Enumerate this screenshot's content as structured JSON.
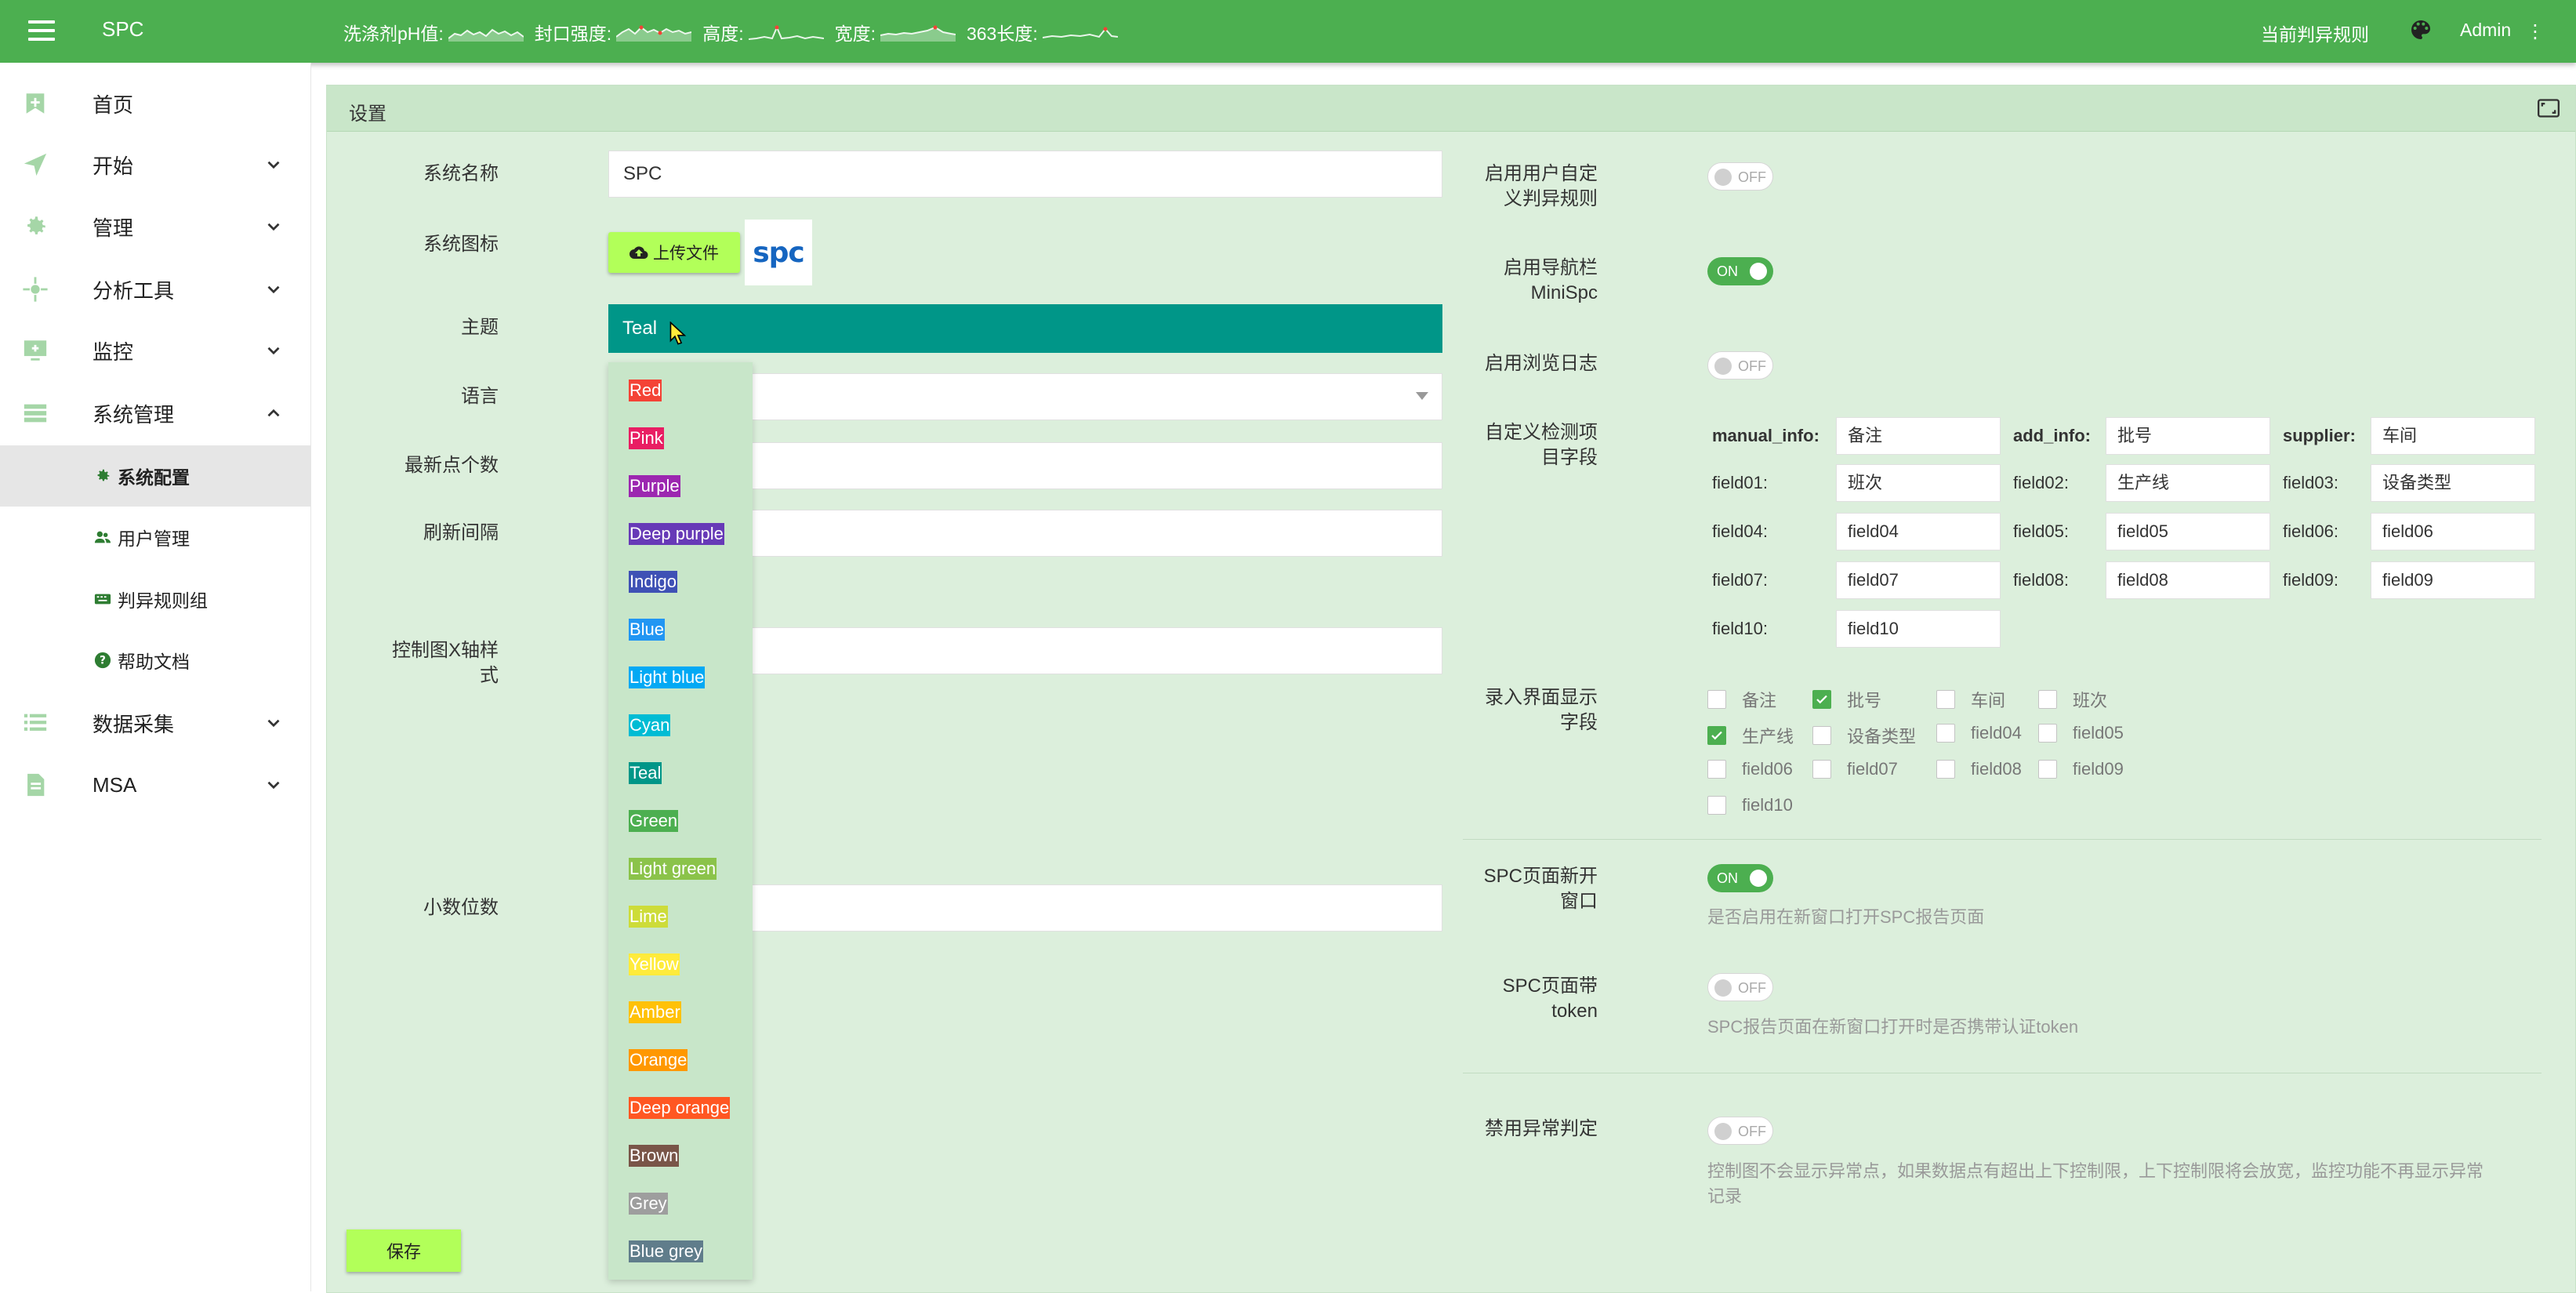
{
  "topbar": {
    "title": "SPC",
    "metrics": [
      {
        "label": "洗涤剂pH值:"
      },
      {
        "label": "封口强度:"
      },
      {
        "label": "高度:"
      },
      {
        "label": "宽度:"
      },
      {
        "label": "363长度:"
      }
    ],
    "rule_link": "当前判异规则",
    "user": "Admin",
    "more": "⋮"
  },
  "sidebar": {
    "items": [
      {
        "label": "首页",
        "icon": "home-plus-icon"
      },
      {
        "label": "开始",
        "icon": "send-icon"
      },
      {
        "label": "管理",
        "icon": "gear-icon"
      },
      {
        "label": "分析工具",
        "icon": "crosshair-icon"
      },
      {
        "label": "监控",
        "icon": "monitor-icon"
      },
      {
        "label": "系统管理",
        "icon": "list-icon"
      }
    ],
    "sub_items": [
      {
        "label": "系统配置",
        "icon": "gear-icon"
      },
      {
        "label": "用户管理",
        "icon": "users-icon"
      },
      {
        "label": "判异规则组",
        "icon": "keyboard-icon"
      },
      {
        "label": "帮助文档",
        "icon": "help-icon"
      }
    ],
    "bottom_items": [
      {
        "label": "数据采集",
        "icon": "list-check-icon"
      },
      {
        "label": "MSA",
        "icon": "document-icon"
      }
    ]
  },
  "panel": {
    "title": "设置",
    "left": {
      "system_name_label": "系统名称",
      "system_name_value": "SPC",
      "system_icon_label": "系统图标",
      "upload_label": "上传文件",
      "logo_text": "spc",
      "theme_label": "主题",
      "theme_value": "Teal",
      "language_label": "语言",
      "latest_points_label": "最新点个数",
      "refresh_label": "刷新间隔",
      "xaxis_label_1": "控制图X轴样",
      "xaxis_label_2": "式",
      "decimal_label": "小数位数",
      "save_label": "保存"
    },
    "themes": [
      {
        "name": "Red",
        "color": "#f44336",
        "text": "#ffffff"
      },
      {
        "name": "Pink",
        "color": "#e91e63",
        "text": "#ffffff"
      },
      {
        "name": "Purple",
        "color": "#9c27b0",
        "text": "#ffffff"
      },
      {
        "name": "Deep purple",
        "color": "#673ab7",
        "text": "#ffffff"
      },
      {
        "name": "Indigo",
        "color": "#3f51b5",
        "text": "#ffffff"
      },
      {
        "name": "Blue",
        "color": "#2196f3",
        "text": "#ffffff"
      },
      {
        "name": "Light blue",
        "color": "#03a9f4",
        "text": "#ffffff"
      },
      {
        "name": "Cyan",
        "color": "#00bcd4",
        "text": "#ffffff"
      },
      {
        "name": "Teal",
        "color": "#009688",
        "text": "#ffffff"
      },
      {
        "name": "Green",
        "color": "#4caf50",
        "text": "#ffffff"
      },
      {
        "name": "Light green",
        "color": "#8bc34a",
        "text": "#ffffff"
      },
      {
        "name": "Lime",
        "color": "#cddc39",
        "text": "#ffffff"
      },
      {
        "name": "Yellow",
        "color": "#ffeb3b",
        "text": "#ffffff"
      },
      {
        "name": "Amber",
        "color": "#ffc107",
        "text": "#ffffff"
      },
      {
        "name": "Orange",
        "color": "#ff9800",
        "text": "#ffffff"
      },
      {
        "name": "Deep orange",
        "color": "#ff5722",
        "text": "#ffffff"
      },
      {
        "name": "Brown",
        "color": "#795548",
        "text": "#ffffff"
      },
      {
        "name": "Grey",
        "color": "#9e9e9e",
        "text": "#ffffff"
      },
      {
        "name": "Blue grey",
        "color": "#607d8b",
        "text": "#ffffff"
      }
    ],
    "right": {
      "custom_rule_label_1": "启用用户自定",
      "custom_rule_label_2": "义判异规则",
      "custom_rule_state": "OFF",
      "nav_label_1": "启用导航栏",
      "nav_label_2": "MiniSpc",
      "nav_state": "ON",
      "browse_log_label": "启用浏览日志",
      "browse_log_state": "OFF",
      "custom_fields_label_1": "自定义检测项",
      "custom_fields_label_2": "目字段",
      "fields": [
        {
          "key": "manual_info:",
          "value": "备注",
          "bold": true
        },
        {
          "key": "add_info:",
          "value": "批号",
          "bold": true
        },
        {
          "key": "supplier:",
          "value": "车间",
          "bold": true
        },
        {
          "key": "field01:",
          "value": "班次"
        },
        {
          "key": "field02:",
          "value": "生产线"
        },
        {
          "key": "field03:",
          "value": "设备类型"
        },
        {
          "key": "field04:",
          "value": "field04"
        },
        {
          "key": "field05:",
          "value": "field05"
        },
        {
          "key": "field06:",
          "value": "field06"
        },
        {
          "key": "field07:",
          "value": "field07"
        },
        {
          "key": "field08:",
          "value": "field08"
        },
        {
          "key": "field09:",
          "value": "field09"
        },
        {
          "key": "field10:",
          "value": "field10"
        }
      ],
      "display_fields_label_1": "录入界面显示",
      "display_fields_label_2": "字段",
      "checkboxes": [
        {
          "label": "备注",
          "checked": false
        },
        {
          "label": "批号",
          "checked": true
        },
        {
          "label": "车间",
          "checked": false
        },
        {
          "label": "班次",
          "checked": false
        },
        {
          "label": "生产线",
          "checked": true
        },
        {
          "label": "设备类型",
          "checked": false
        },
        {
          "label": "field04",
          "checked": false
        },
        {
          "label": "field05",
          "checked": false
        },
        {
          "label": "field06",
          "checked": false
        },
        {
          "label": "field07",
          "checked": false
        },
        {
          "label": "field08",
          "checked": false
        },
        {
          "label": "field09",
          "checked": false
        },
        {
          "label": "field10",
          "checked": false
        }
      ],
      "new_window_label_1": "SPC页面新开",
      "new_window_label_2": "窗口",
      "new_window_state": "ON",
      "new_window_hint": "是否启用在新窗口打开SPC报告页面",
      "token_label_1": "SPC页面带",
      "token_label_2": "token",
      "token_state": "OFF",
      "token_hint": "SPC报告页面在新窗口打开时是否携带认证token",
      "disable_judge_label": "禁用异常判定",
      "disable_judge_state": "OFF",
      "disable_judge_hint_1": "控制图不会显示异常点，如果数据点有超出上下控制限，上下控制限将会放宽，监控功能不再显示异常",
      "disable_judge_hint_2": "记录"
    }
  }
}
